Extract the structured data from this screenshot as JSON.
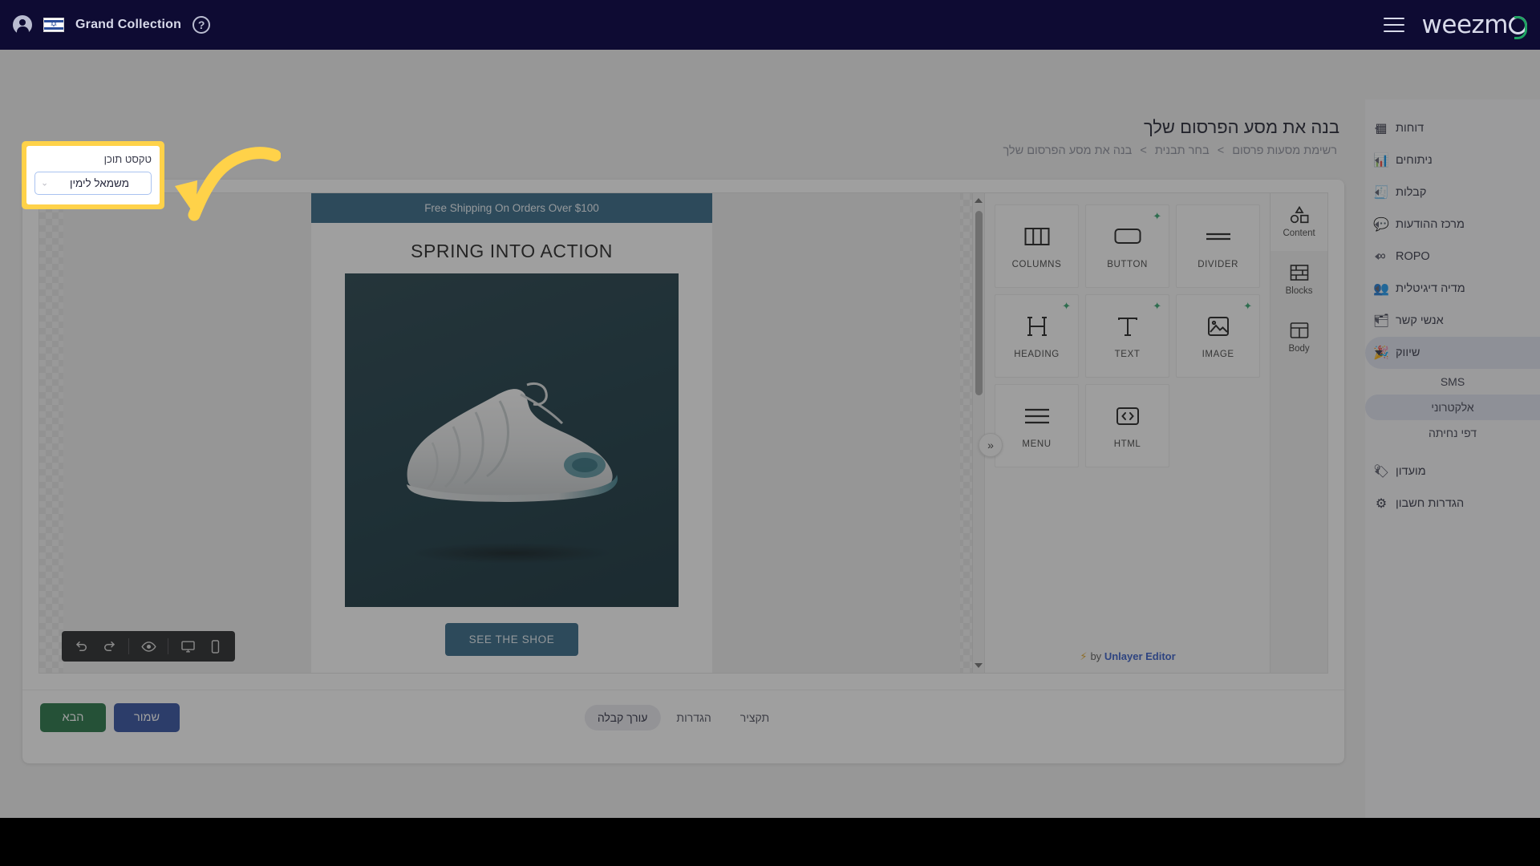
{
  "topbar": {
    "account_icon": "user-circle-icon",
    "flag_icon": "israel-flag-icon",
    "brand": "Grand Collection",
    "help_icon": "help-question-icon",
    "menu_icon": "hamburger-menu-icon",
    "logo": "weezm",
    "logo_accent_color": "#1fa463"
  },
  "sidebar": {
    "items": [
      {
        "label": "דוחות",
        "icon": "dashboard-icon",
        "expandable": true,
        "active": false
      },
      {
        "label": "ניתוחים",
        "icon": "analytics-icon",
        "expandable": true,
        "active": false
      },
      {
        "label": "קבלות",
        "icon": "receipt-icon",
        "expandable": true,
        "active": false
      },
      {
        "label": "מרכז ההודעות",
        "icon": "message-center-icon",
        "expandable": true,
        "active": false
      },
      {
        "label": "ROPO",
        "icon": "infinity-icon",
        "expandable": true,
        "active": false
      },
      {
        "label": "מדיה דיגיטלית",
        "icon": "digital-media-icon",
        "expandable": true,
        "active": false
      },
      {
        "label": "אנשי קשר",
        "icon": "contacts-icon",
        "expandable": true,
        "active": false
      },
      {
        "label": "שיווק",
        "icon": "marketing-icon",
        "expandable": true,
        "active": true
      }
    ],
    "sub_items": [
      {
        "label": "SMS",
        "active": false
      },
      {
        "label": "אלקטרוני",
        "active": true
      },
      {
        "label": "דפי נחיתה",
        "active": false
      }
    ],
    "bottom_items": [
      {
        "label": "מועדון",
        "icon": "tag-icon",
        "expandable": true
      },
      {
        "label": "הגדרות חשבון",
        "icon": "gear-icon",
        "expandable": false
      }
    ]
  },
  "page": {
    "title": "בנה את מסע הפרסום שלך",
    "breadcrumb": {
      "item1": "רשימת מסעות פרסום",
      "sep1": ">",
      "item2": "בחר תבנית",
      "sep2": ">",
      "item3": "בנה את מסע הפרסום שלך"
    }
  },
  "email_preview": {
    "banner": "Free Shipping On Orders Over $100",
    "heading": "SPRING INTO ACTION",
    "cta": "SEE THE SHOE",
    "banner_color": "#2e6382",
    "cta_color": "#2e6382",
    "image_alt": "sneaker-product-photo"
  },
  "mini_toolbar": {
    "undo_icon": "undo-arrow-icon",
    "redo_icon": "redo-arrow-icon",
    "preview_icon": "eye-preview-icon",
    "desktop_icon": "desktop-monitor-icon",
    "mobile_icon": "mobile-phone-icon"
  },
  "collapse_button": {
    "glyph": "»",
    "name": "collapse-panel-chevrons"
  },
  "tools": {
    "tiles": [
      {
        "label": "COLUMNS",
        "icon": "columns-icon",
        "ai_badge": false
      },
      {
        "label": "BUTTON",
        "icon": "button-icon",
        "ai_badge": true
      },
      {
        "label": "DIVIDER",
        "icon": "divider-icon",
        "ai_badge": false
      },
      {
        "label": "HEADING",
        "icon": "heading-h-icon",
        "ai_badge": true
      },
      {
        "label": "TEXT",
        "icon": "text-t-icon",
        "ai_badge": true
      },
      {
        "label": "IMAGE",
        "icon": "image-icon",
        "ai_badge": true
      },
      {
        "label": "MENU",
        "icon": "menu-lines-icon",
        "ai_badge": false
      },
      {
        "label": "HTML",
        "icon": "code-brackets-icon",
        "ai_badge": false
      }
    ],
    "rail_tabs": [
      {
        "label": "Content",
        "icon": "shapes-icon",
        "active": true
      },
      {
        "label": "Blocks",
        "icon": "bricks-icon",
        "active": false
      },
      {
        "label": "Body",
        "icon": "layout-icon",
        "active": false
      }
    ],
    "footer_by": "by",
    "footer_link": "Unlayer Editor",
    "footer_bolt": "⚡"
  },
  "footer": {
    "tabs": [
      {
        "label": "עורך קבלה",
        "active": true
      },
      {
        "label": "הגדרות",
        "active": false
      },
      {
        "label": "תקציר",
        "active": false
      }
    ],
    "save_label": "שמור",
    "next_label": "הבא",
    "save_color": "#2b4b9e",
    "next_color": "#1e7040"
  },
  "callout": {
    "field_label": "טקסט תוכן",
    "select_value": "משמאל לימין",
    "chevron": "⌄",
    "highlight_color": "#ffd249",
    "arrow_icon": "curved-arrow-left-icon"
  }
}
